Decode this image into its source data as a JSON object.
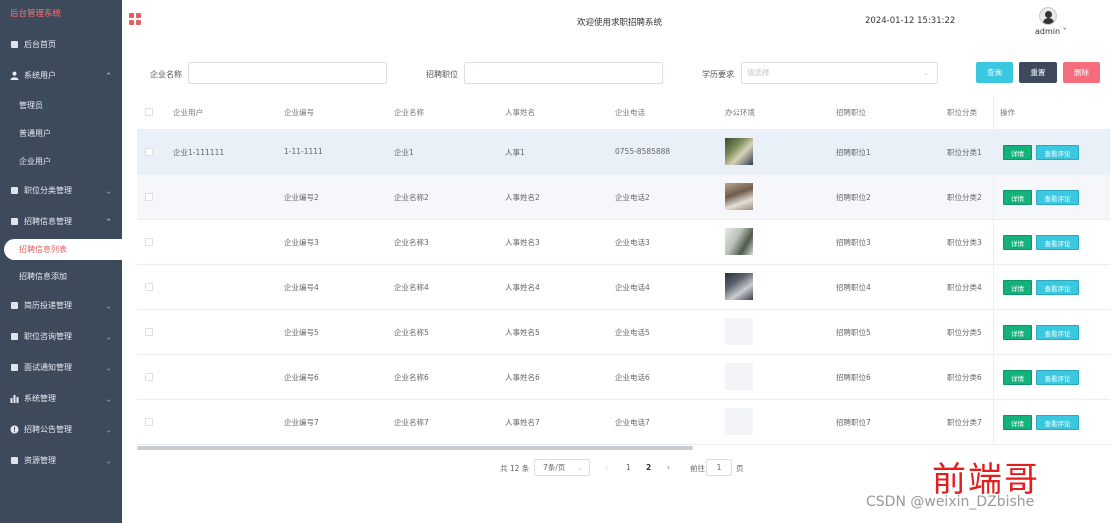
{
  "brand": "后台管理系统",
  "sidebar": {
    "items": [
      {
        "label": "后台首页",
        "icon": "home-icon"
      },
      {
        "label": "系统用户",
        "icon": "user-icon",
        "open": true,
        "children": [
          "管理员",
          "普通用户",
          "企业用户"
        ]
      },
      {
        "label": "职位分类管理",
        "icon": "grid-icon"
      },
      {
        "label": "招聘信息管理",
        "icon": "doc-icon",
        "open": true,
        "children": [
          "招聘信息列表",
          "招聘信息添加"
        ]
      },
      {
        "label": "简历投递管理",
        "icon": "grid-icon"
      },
      {
        "label": "职位咨询管理",
        "icon": "grid-icon"
      },
      {
        "label": "面试通知管理",
        "icon": "grid-icon"
      },
      {
        "label": "系统管理",
        "icon": "bar-icon"
      },
      {
        "label": "招聘公告管理",
        "icon": "info-icon"
      },
      {
        "label": "资源管理",
        "icon": "doc-icon"
      }
    ],
    "active": "招聘信息列表"
  },
  "header": {
    "title": "欢迎使用求职招聘系统",
    "time": "2024-01-12 15:31:22",
    "user": "admin"
  },
  "search": {
    "company_name_label": "企业名称",
    "position_label": "招聘职位",
    "education_label": "学历要求",
    "education_placeholder": "请选择",
    "query": "查询",
    "reset": "重置",
    "delete": "删除"
  },
  "table": {
    "headers": [
      "企业用户",
      "企业编号",
      "企业名称",
      "人事姓名",
      "企业电话",
      "办公环境",
      "招聘职位",
      "职位分类",
      "操作"
    ],
    "rows": [
      {
        "user": "企业1-111111",
        "code": "1-11-1111",
        "name": "企业1",
        "hr": "人事1",
        "phone": "0755-8585888",
        "pos": "招聘职位1",
        "cat": "职位分类1"
      },
      {
        "user": "",
        "code": "企业编号2",
        "name": "企业名称2",
        "hr": "人事姓名2",
        "phone": "企业电话2",
        "pos": "招聘职位2",
        "cat": "职位分类2"
      },
      {
        "user": "",
        "code": "企业编号3",
        "name": "企业名称3",
        "hr": "人事姓名3",
        "phone": "企业电话3",
        "pos": "招聘职位3",
        "cat": "职位分类3"
      },
      {
        "user": "",
        "code": "企业编号4",
        "name": "企业名称4",
        "hr": "人事姓名4",
        "phone": "企业电话4",
        "pos": "招聘职位4",
        "cat": "职位分类4"
      },
      {
        "user": "",
        "code": "企业编号5",
        "name": "企业名称5",
        "hr": "人事姓名5",
        "phone": "企业电话5",
        "pos": "招聘职位5",
        "cat": "职位分类5"
      },
      {
        "user": "",
        "code": "企业编号6",
        "name": "企业名称6",
        "hr": "人事姓名6",
        "phone": "企业电话6",
        "pos": "招聘职位6",
        "cat": "职位分类6"
      },
      {
        "user": "",
        "code": "企业编号7",
        "name": "企业名称7",
        "hr": "人事姓名7",
        "phone": "企业电话7",
        "pos": "招聘职位7",
        "cat": "职位分类7"
      }
    ],
    "detail_btn": "详情",
    "review_btn": "查看评论"
  },
  "pager": {
    "total": "共 12 条",
    "size": "7条/页",
    "prev": "‹",
    "pages": [
      "1",
      "2"
    ],
    "next": "›",
    "goto": "前往",
    "current": "1",
    "unit": "页"
  },
  "watermark": "前端哥",
  "csdn": "CSDN @weixin_DZbishe",
  "colors": {
    "sidebar": "#3d4a5c",
    "accent": "#e85d5d",
    "query": "#39c8df",
    "reset": "#3d4a5c",
    "delete": "#f56c7c",
    "detail": "#13b27b"
  }
}
